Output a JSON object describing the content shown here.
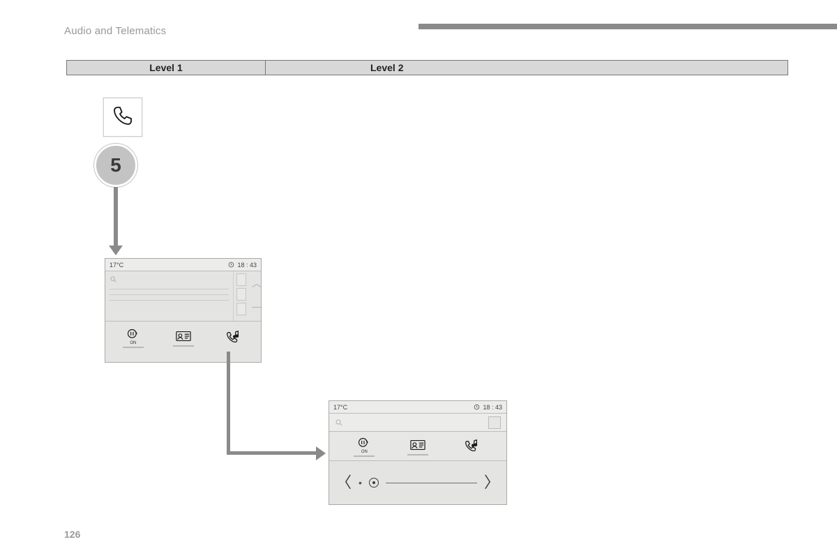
{
  "header": {
    "section_title": "Audio and Telematics"
  },
  "level_header": {
    "col1": "Level 1",
    "col2": "Level 2"
  },
  "step": {
    "number": "5"
  },
  "screen1": {
    "temp": "17°C",
    "time": "18 : 43",
    "tabs": {
      "hold_sub": "ON"
    }
  },
  "screen2": {
    "temp": "17°C",
    "time": "18 : 43",
    "tabs": {
      "hold_sub": "ON"
    }
  },
  "page_number": "126"
}
